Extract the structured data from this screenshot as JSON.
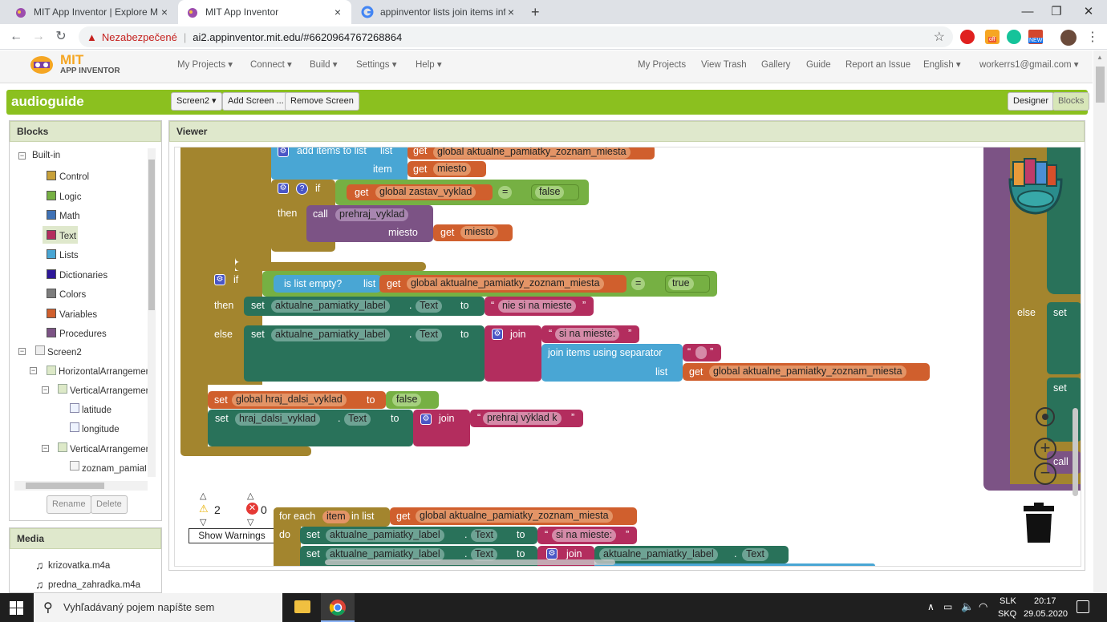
{
  "browser": {
    "tabs": [
      {
        "title": "MIT App Inventor | Explore MIT A",
        "close": "×"
      },
      {
        "title": "MIT App Inventor",
        "close": "×"
      },
      {
        "title": "appinventor lists join items infini",
        "close": "×"
      }
    ],
    "new_tab": "+",
    "window": {
      "minimize": "—",
      "restore": "❐",
      "close": "✕"
    },
    "security": "Nezabezpečené",
    "url": "ai2.appinventor.mit.edu/#6620964767268864",
    "ext_badges": {
      "off": "off",
      "new": "NEW"
    }
  },
  "appheader": {
    "logo_mit": "MIT",
    "logo_sub": "APP INVENTOR",
    "menus": [
      "My Projects ▾",
      "Connect ▾",
      "Build ▾",
      "Settings ▾",
      "Help ▾"
    ],
    "links": [
      "My Projects",
      "View Trash",
      "Gallery",
      "Guide",
      "Report an Issue",
      "English ▾",
      "workerrs1@gmail.com ▾"
    ]
  },
  "project": {
    "name": "audioguide",
    "screen": "Screen2 ▾",
    "add_screen": "Add Screen ...",
    "remove_screen": "Remove Screen",
    "designer": "Designer",
    "blocks": "Blocks"
  },
  "blocks_panel": {
    "title": "Blocks",
    "builtin": "Built-in",
    "items": [
      {
        "label": "Control",
        "color": "#c8a13a"
      },
      {
        "label": "Logic",
        "color": "#76b043"
      },
      {
        "label": "Math",
        "color": "#3f71b5"
      },
      {
        "label": "Text",
        "color": "#b32d5e"
      },
      {
        "label": "Lists",
        "color": "#49a6d4"
      },
      {
        "label": "Dictionaries",
        "color": "#2d1799"
      },
      {
        "label": "Colors",
        "color": "#7d7d7d"
      },
      {
        "label": "Variables",
        "color": "#d05f2d"
      },
      {
        "label": "Procedures",
        "color": "#7c5385"
      }
    ],
    "tree": [
      "Screen2",
      "HorizontalArrangemen",
      "VerticalArrangemer",
      "latitude",
      "longitude",
      "VerticalArrangemer",
      "zoznam_pamiatc"
    ],
    "rename": "Rename",
    "delete": "Delete"
  },
  "media": {
    "title": "Media",
    "files": [
      "krizovatka.m4a",
      "predna_zahradka.m4a"
    ]
  },
  "viewer": {
    "title": "Viewer",
    "warnings_count": "2",
    "errors_count": "0",
    "show_warnings": "Show Warnings"
  },
  "blocks": {
    "add_items": "add items to list",
    "list": "list",
    "get": "get",
    "item": "item",
    "var_zoznam": "global aktualne_pamiatky_zoznam_miesta",
    "miesto": "miesto",
    "if": "if",
    "var_zastav": "global zastav_vyklad",
    "eq": "=",
    "false": "false",
    "true": "true",
    "then": "then",
    "else": "else",
    "call": "call",
    "proc": "prehraj_vyklad",
    "is_empty": "is list empty?",
    "set": "set",
    "label": "aktualne_pamiatky_label",
    "text_prop": "Text",
    "to": "to",
    "nie_si": "nie si na mieste",
    "join": "join",
    "si_na": "si na mieste:",
    "join_sep": "join items using separator",
    "set_global": "global hraj_dalsi_vyklad",
    "hraj_label": "hraj_dalsi_vyklad",
    "prehraj_k": "prehraj výklad k",
    "for_each": "for each",
    "in_list": "in list",
    "do": "do",
    "dot": "."
  },
  "right_blocks": {
    "else": "else",
    "set1": "set",
    "set2": "set",
    "call": "call"
  },
  "taskbar": {
    "search": "Vyhľadávaný pojem napíšte sem",
    "lang1": "SLK",
    "lang2": "SKQ",
    "time": "20:17",
    "date": "29.05.2020"
  }
}
